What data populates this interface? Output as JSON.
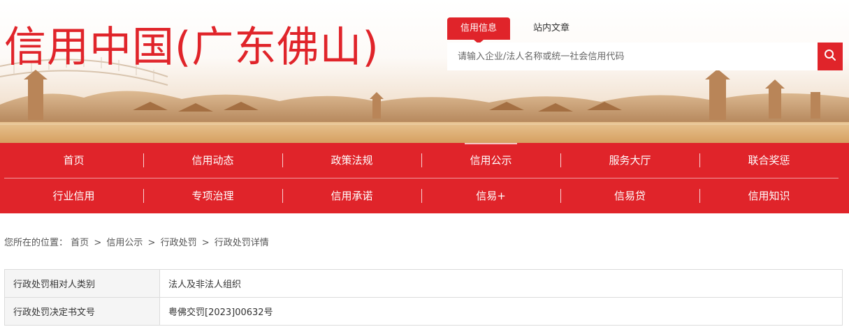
{
  "site": {
    "title": "信用中国(广东佛山)"
  },
  "search": {
    "tabs": [
      {
        "label": "信用信息",
        "active": true
      },
      {
        "label": "站内文章",
        "active": false
      }
    ],
    "placeholder": "请输入企业/法人名称或统一社会信用代码",
    "button_icon": "search-icon"
  },
  "nav": {
    "row1": [
      "首页",
      "信用动态",
      "政策法规",
      "信用公示",
      "服务大厅",
      "联合奖惩"
    ],
    "row2": [
      "行业信用",
      "专项治理",
      "信用承诺",
      "信易+",
      "信易贷",
      "信用知识"
    ],
    "active": "信用公示"
  },
  "breadcrumb": {
    "prefix": "您所在的位置：",
    "items": [
      "首页",
      "信用公示",
      "行政处罚",
      "行政处罚详情"
    ],
    "separator": ">"
  },
  "details": [
    {
      "key": "行政处罚相对人类别",
      "value": "法人及非法人组织"
    },
    {
      "key": "行政处罚决定书文号",
      "value": "粤佛交罚[2023]00632号"
    }
  ],
  "colors": {
    "brand_red": "#e0242a"
  }
}
